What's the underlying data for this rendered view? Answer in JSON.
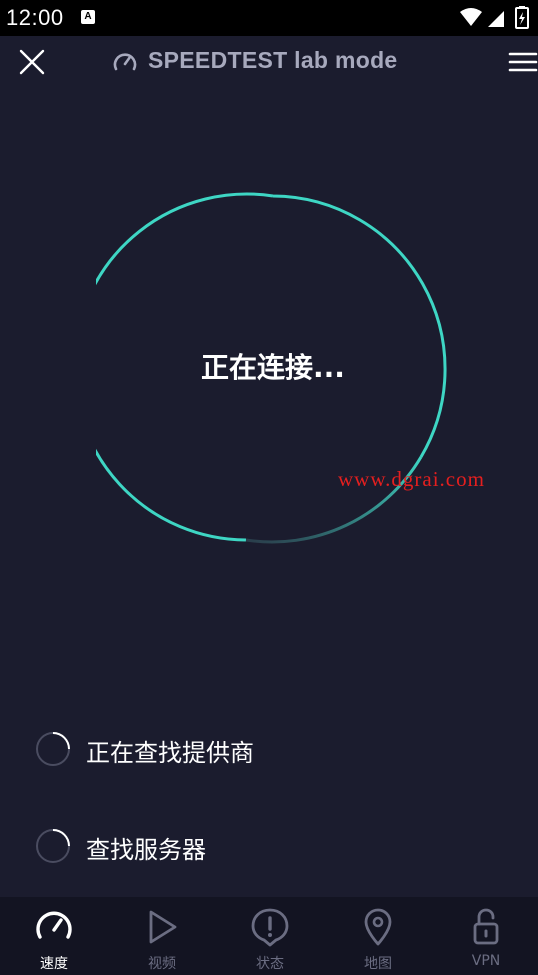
{
  "status_bar": {
    "time": "12:00",
    "notification_letter": "A"
  },
  "header": {
    "title": "SPEEDTEST lab mode"
  },
  "gauge": {
    "status_text": "正在连接...",
    "colors": {
      "ring": "#3ed6c4",
      "ring_dim": "#2a4f55",
      "background": "#1b1c2e"
    }
  },
  "watermark": {
    "text": "www.dgrai.com",
    "color": "#e41f1f"
  },
  "progress": [
    {
      "label": "正在查找提供商"
    },
    {
      "label": "查找服务器"
    }
  ],
  "bottom_nav": {
    "items": [
      {
        "label": "速度",
        "icon": "speedometer-icon",
        "active": true
      },
      {
        "label": "视频",
        "icon": "play-icon",
        "active": false
      },
      {
        "label": "状态",
        "icon": "alert-icon",
        "active": false
      },
      {
        "label": "地图",
        "icon": "map-pin-icon",
        "active": false
      },
      {
        "label": "VPN",
        "icon": "unlock-icon",
        "active": false
      }
    ]
  }
}
